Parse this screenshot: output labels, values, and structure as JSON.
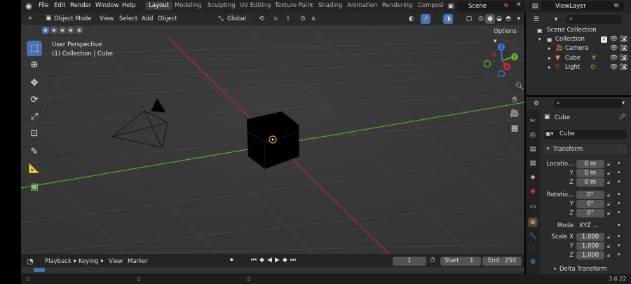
{
  "topbar": {
    "menus": [
      "File",
      "Edit",
      "Render",
      "Window",
      "Help"
    ],
    "workspaces": [
      "Layout",
      "Modeling",
      "Sculpting",
      "UV Editing",
      "Texture Paint",
      "Shading",
      "Animation",
      "Rendering",
      "Composi"
    ],
    "active_workspace": "Layout",
    "scene": "Scene",
    "view_layer": "ViewLayer"
  },
  "viewport": {
    "mode": "Object Mode",
    "menus": [
      "View",
      "Select",
      "Add",
      "Object"
    ],
    "orientation": "Global",
    "options_label": "Options",
    "overlay_line1": "User Perspective",
    "overlay_line2": "(1) Collection | Cube",
    "gizmo": {
      "x": "X",
      "y": "Y",
      "z": "Z"
    }
  },
  "timeline": {
    "menus": [
      "Playback",
      "Keying",
      "View",
      "Marker"
    ],
    "current_frame": "1",
    "start_label": "Start",
    "start_value": "1",
    "end_label": "End",
    "end_value": "250"
  },
  "outliner": {
    "root": "Scene Collection",
    "collection": "Collection",
    "items": [
      "Camera",
      "Cube",
      "Light"
    ]
  },
  "properties": {
    "object_name": "Cube",
    "data_name": "Cube",
    "transform_label": "Transform",
    "location_label": "Locatio...",
    "rotation_label": "Rotatio...",
    "scale_label": "Scale X",
    "axis_y": "Y",
    "axis_z": "Z",
    "location": [
      "0 m",
      "0 m",
      "0 m"
    ],
    "rotation": [
      "0°",
      "0°",
      "0°"
    ],
    "mode_label": "Mode",
    "mode_value": "XYZ ...",
    "scale": [
      "1.000",
      "1.000",
      "1.000"
    ],
    "delta_label": "Delta Transform"
  },
  "status": {
    "version": "3.6.22"
  },
  "colors": {
    "accent": "#4772b3",
    "x_axis": "#c62b3f",
    "y_axis": "#6bb22c",
    "z_axis": "#3d7be0",
    "panel": "#2b2b2b"
  }
}
